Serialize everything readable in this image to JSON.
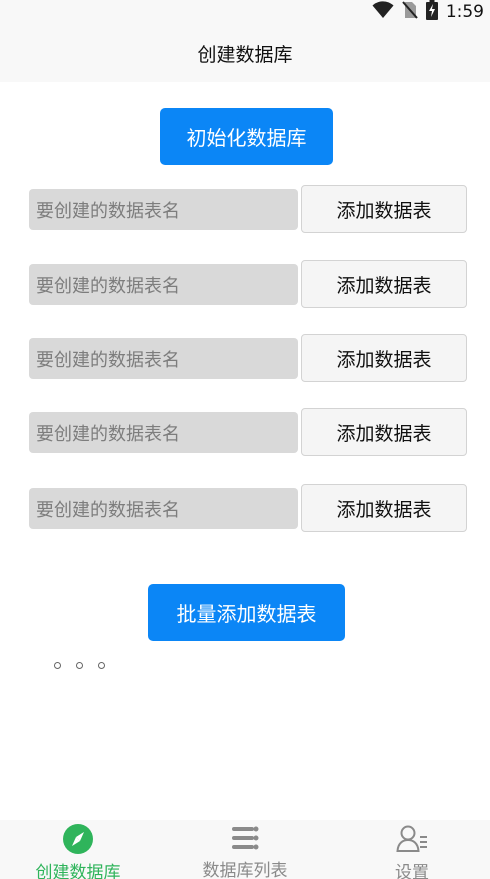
{
  "status_bar": {
    "time": "1:59",
    "icons": [
      "wifi-icon",
      "no-sim-icon",
      "battery-charging-icon"
    ]
  },
  "header": {
    "title": "创建数据库"
  },
  "init_button": {
    "label": "初始化数据库"
  },
  "table_rows": [
    {
      "placeholder": "要创建的数据表名",
      "button_label": "添加数据表"
    },
    {
      "placeholder": "要创建的数据表名",
      "button_label": "添加数据表"
    },
    {
      "placeholder": "要创建的数据表名",
      "button_label": "添加数据表"
    },
    {
      "placeholder": "要创建的数据表名",
      "button_label": "添加数据表"
    },
    {
      "placeholder": "要创建的数据表名",
      "button_label": "添加数据表"
    }
  ],
  "batch_button": {
    "label": "批量添加数据表"
  },
  "bottom_nav": {
    "items": [
      {
        "label": "创建数据库",
        "icon": "compass-icon",
        "active": true
      },
      {
        "label": "数据库列表",
        "icon": "list-icon",
        "active": false
      },
      {
        "label": "设置",
        "icon": "user-settings-icon",
        "active": false
      }
    ]
  },
  "colors": {
    "primary": "#0b86f6",
    "active_tab": "#2fb45b",
    "inactive_tab": "#8a8a8a",
    "input_bg": "#d9d9d9"
  }
}
